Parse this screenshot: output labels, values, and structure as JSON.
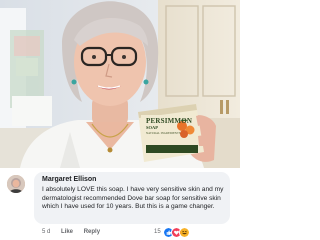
{
  "soap": {
    "brand": "PERSIMMON",
    "product": "SOAP",
    "tagline": "NATURAL INGREDIENTS"
  },
  "comment": {
    "author": "Margaret Ellison",
    "text": "I absolutely LOVE this soap. I have very sensitive skin and my dermatologist recommended Dove bar soap for sensitive skin which I have used for 10 years. But this is a game changer.",
    "age": "5 d",
    "like_label": "Like",
    "reply_label": "Reply",
    "reaction_count": "15",
    "reactions": [
      "like-icon",
      "love-icon",
      "haha-icon"
    ]
  },
  "colors": {
    "bubble": "#f0f2f5",
    "like_blue": "#1877f2",
    "love_red": "#f33e58",
    "haha_yellow": "#f7b125",
    "soap_box": "#f1ead2",
    "soap_green": "#2e4a22"
  }
}
